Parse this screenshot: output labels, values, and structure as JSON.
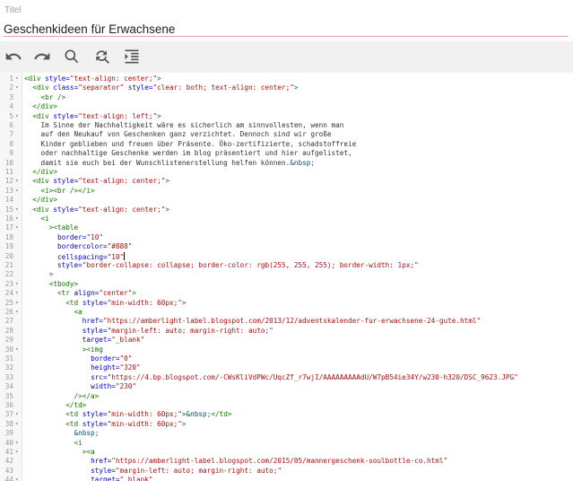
{
  "form": {
    "title_label": "Titel",
    "title_value": "Geschenkideen für Erwachsene"
  },
  "toolbar": {
    "buttons": [
      "undo-icon",
      "redo-icon",
      "search-icon",
      "replace-icon",
      "format-icon"
    ]
  },
  "editor": {
    "lines": [
      {
        "n": "1",
        "f": "▾",
        "t": [
          [
            "t",
            "<div "
          ],
          [
            "a",
            "style="
          ],
          [
            "s",
            "\"text-align: center;\""
          ],
          [
            "t",
            ">"
          ]
        ]
      },
      {
        "n": "2",
        "f": "▾",
        "t": [
          [
            "c",
            "  "
          ],
          [
            "t",
            "<div "
          ],
          [
            "a",
            "class="
          ],
          [
            "s",
            "\"separator\""
          ],
          [
            "c",
            " "
          ],
          [
            "a",
            "style="
          ],
          [
            "s",
            "\"clear: both; text-align: center;\""
          ],
          [
            "t",
            ">"
          ]
        ]
      },
      {
        "n": "3",
        "f": "",
        "t": [
          [
            "c",
            "    "
          ],
          [
            "t",
            "<br />"
          ]
        ]
      },
      {
        "n": "4",
        "f": "",
        "t": [
          [
            "c",
            "  "
          ],
          [
            "t",
            "</div>"
          ]
        ]
      },
      {
        "n": "5",
        "f": "▾",
        "t": [
          [
            "c",
            "  "
          ],
          [
            "t",
            "<div "
          ],
          [
            "a",
            "style="
          ],
          [
            "s",
            "\"text-align: left;\""
          ],
          [
            "t",
            ">"
          ]
        ]
      },
      {
        "n": "6",
        "f": "",
        "t": [
          [
            "c",
            "    Im Sinne der Nachhaltigkeit wäre es sicherlich am sinnvollesten, wenn man"
          ]
        ]
      },
      {
        "n": "7",
        "f": "",
        "t": [
          [
            "c",
            "    auf den Neukauf von Geschenken ganz verzichtet. Dennoch sind wir große"
          ]
        ]
      },
      {
        "n": "8",
        "f": "",
        "t": [
          [
            "c",
            "    Kinder geblieben und freuen über Präsente. Öko-zertifizierte, schadstoffreie"
          ]
        ]
      },
      {
        "n": "9",
        "f": "",
        "t": [
          [
            "c",
            "    oder nachhaltige Geschenke werden im blog präsentiert und hier aufgelistet,"
          ]
        ]
      },
      {
        "n": "10",
        "f": "",
        "t": [
          [
            "c",
            "    damit sie euch bei der Wunschlistenerstellung helfen können."
          ],
          [
            "e",
            "&nbsp;"
          ]
        ]
      },
      {
        "n": "11",
        "f": "",
        "t": [
          [
            "c",
            "  "
          ],
          [
            "t",
            "</div>"
          ]
        ]
      },
      {
        "n": "12",
        "f": "▾",
        "t": [
          [
            "c",
            "  "
          ],
          [
            "t",
            "<div "
          ],
          [
            "a",
            "style="
          ],
          [
            "s",
            "\"text-align: center;\""
          ],
          [
            "t",
            ">"
          ]
        ]
      },
      {
        "n": "13",
        "f": "▾",
        "t": [
          [
            "c",
            "    "
          ],
          [
            "t",
            "<i><br /></i>"
          ]
        ]
      },
      {
        "n": "14",
        "f": "",
        "t": [
          [
            "c",
            "  "
          ],
          [
            "t",
            "</div>"
          ]
        ]
      },
      {
        "n": "15",
        "f": "▾",
        "t": [
          [
            "c",
            "  "
          ],
          [
            "t",
            "<div "
          ],
          [
            "a",
            "style="
          ],
          [
            "s",
            "\"text-align: center;\""
          ],
          [
            "t",
            ">"
          ]
        ]
      },
      {
        "n": "16",
        "f": "▾",
        "t": [
          [
            "c",
            "    "
          ],
          [
            "t",
            "<i"
          ]
        ]
      },
      {
        "n": "17",
        "f": "▾",
        "t": [
          [
            "c",
            "      "
          ],
          [
            "t",
            "><table"
          ]
        ]
      },
      {
        "n": "18",
        "f": "",
        "t": [
          [
            "c",
            "        "
          ],
          [
            "a",
            "border="
          ],
          [
            "s",
            "\"10\""
          ]
        ]
      },
      {
        "n": "19",
        "f": "",
        "t": [
          [
            "c",
            "        "
          ],
          [
            "a",
            "bordercolor="
          ],
          [
            "s",
            "\"#888\""
          ]
        ]
      },
      {
        "n": "20",
        "f": "",
        "t": [
          [
            "c",
            "        "
          ],
          [
            "a",
            "cellspacing="
          ],
          [
            "s",
            "\"10\""
          ],
          [
            "k",
            ""
          ]
        ]
      },
      {
        "n": "21",
        "f": "",
        "t": [
          [
            "c",
            "        "
          ],
          [
            "a",
            "style="
          ],
          [
            "s",
            "\"border-collapse: collapse; border-color: rgb(255, 255, 255); border-width: 1px;\""
          ]
        ]
      },
      {
        "n": "22",
        "f": "",
        "t": [
          [
            "c",
            "      "
          ],
          [
            "t",
            ">"
          ]
        ]
      },
      {
        "n": "23",
        "f": "▾",
        "t": [
          [
            "c",
            "      "
          ],
          [
            "t",
            "<tbody>"
          ]
        ]
      },
      {
        "n": "24",
        "f": "▾",
        "t": [
          [
            "c",
            "        "
          ],
          [
            "t",
            "<tr "
          ],
          [
            "a",
            "align="
          ],
          [
            "s",
            "\"center\""
          ],
          [
            "t",
            ">"
          ]
        ]
      },
      {
        "n": "25",
        "f": "▾",
        "t": [
          [
            "c",
            "          "
          ],
          [
            "t",
            "<td "
          ],
          [
            "a",
            "style="
          ],
          [
            "s",
            "\"min-width: 60px;\""
          ],
          [
            "t",
            ">"
          ]
        ]
      },
      {
        "n": "26",
        "f": "▾",
        "t": [
          [
            "c",
            "            "
          ],
          [
            "t",
            "<a"
          ]
        ]
      },
      {
        "n": "27",
        "f": "",
        "t": [
          [
            "c",
            "              "
          ],
          [
            "a",
            "href="
          ],
          [
            "s",
            "\"https://amberlight-label.blogspot.com/2013/12/adventskalender-fur-erwachsene-24-gute.html\""
          ]
        ]
      },
      {
        "n": "28",
        "f": "",
        "t": [
          [
            "c",
            "              "
          ],
          [
            "a",
            "style="
          ],
          [
            "s",
            "\"margin-left: auto; margin-right: auto;\""
          ]
        ]
      },
      {
        "n": "29",
        "f": "",
        "t": [
          [
            "c",
            "              "
          ],
          [
            "a",
            "target="
          ],
          [
            "s",
            "\"_blank\""
          ]
        ]
      },
      {
        "n": "30",
        "f": "▾",
        "t": [
          [
            "c",
            "              "
          ],
          [
            "t",
            "><img"
          ]
        ]
      },
      {
        "n": "31",
        "f": "",
        "t": [
          [
            "c",
            "                "
          ],
          [
            "a",
            "border="
          ],
          [
            "s",
            "\"0\""
          ]
        ]
      },
      {
        "n": "32",
        "f": "",
        "t": [
          [
            "c",
            "                "
          ],
          [
            "a",
            "height="
          ],
          [
            "s",
            "\"320\""
          ]
        ]
      },
      {
        "n": "33",
        "f": "",
        "t": [
          [
            "c",
            "                "
          ],
          [
            "a",
            "src="
          ],
          [
            "s",
            "\"https://4.bp.blogspot.com/-CWsKliVdPWc/UqcZf_r7wjI/AAAAAAAAAdU/W7pB54ie34Y/w230-h320/DSC_9623.JPG\""
          ]
        ]
      },
      {
        "n": "34",
        "f": "",
        "t": [
          [
            "c",
            "                "
          ],
          [
            "a",
            "width="
          ],
          [
            "s",
            "\"230\""
          ]
        ]
      },
      {
        "n": "35",
        "f": "",
        "t": [
          [
            "c",
            "            "
          ],
          [
            "t",
            "/></a>"
          ]
        ]
      },
      {
        "n": "36",
        "f": "",
        "t": [
          [
            "c",
            "          "
          ],
          [
            "t",
            "</td>"
          ]
        ]
      },
      {
        "n": "37",
        "f": "▾",
        "t": [
          [
            "c",
            "          "
          ],
          [
            "t",
            "<td "
          ],
          [
            "a",
            "style="
          ],
          [
            "s",
            "\"min-width: 60px;\""
          ],
          [
            "t",
            ">"
          ],
          [
            "e",
            "&nbsp;"
          ],
          [
            "t",
            "</td>"
          ]
        ]
      },
      {
        "n": "38",
        "f": "▾",
        "t": [
          [
            "c",
            "          "
          ],
          [
            "t",
            "<td "
          ],
          [
            "a",
            "style="
          ],
          [
            "s",
            "\"min-width: 60px;\""
          ],
          [
            "t",
            ">"
          ]
        ]
      },
      {
        "n": "39",
        "f": "",
        "t": [
          [
            "c",
            "            "
          ],
          [
            "e",
            "&nbsp;"
          ]
        ]
      },
      {
        "n": "40",
        "f": "▾",
        "t": [
          [
            "c",
            "            "
          ],
          [
            "t",
            "<i"
          ]
        ]
      },
      {
        "n": "41",
        "f": "▾",
        "t": [
          [
            "c",
            "              "
          ],
          [
            "t",
            "><a"
          ]
        ]
      },
      {
        "n": "42",
        "f": "",
        "t": [
          [
            "c",
            "                "
          ],
          [
            "a",
            "href="
          ],
          [
            "s",
            "\"https://amberlight-label.blogspot.com/2015/05/mannergeschenk-soulbottle-co.html\""
          ]
        ]
      },
      {
        "n": "43",
        "f": "",
        "t": [
          [
            "c",
            "                "
          ],
          [
            "a",
            "style="
          ],
          [
            "s",
            "\"margin-left: auto; margin-right: auto;\""
          ]
        ]
      },
      {
        "n": "44",
        "f": "▾",
        "t": [
          [
            "c",
            "                "
          ],
          [
            "a",
            "target="
          ],
          [
            "s",
            "\"_blank\""
          ]
        ]
      }
    ]
  }
}
